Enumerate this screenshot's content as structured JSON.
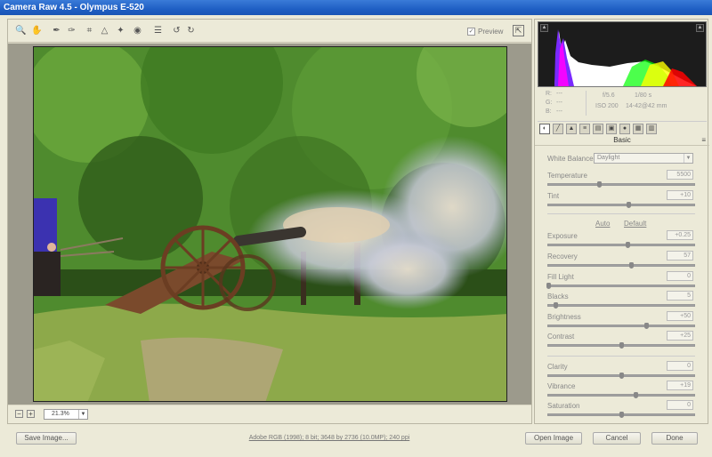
{
  "window": {
    "title": "Camera Raw 4.5  -  Olympus E-520"
  },
  "toolbar": {
    "tools": [
      "zoom-icon",
      "hand-icon",
      "white-balance-icon",
      "color-sampler-icon",
      "crop-icon",
      "straighten-icon",
      "retouch-icon",
      "red-eye-icon",
      "preferences-icon",
      "rotate-left-icon",
      "rotate-right-icon"
    ],
    "preview_label": "Preview",
    "preview_checked": true
  },
  "zoom": {
    "minus": "−",
    "plus": "+",
    "level": "21.3%"
  },
  "histogram": {
    "clip_shadow": "▲",
    "clip_highlight": "▲",
    "colors": [
      "#ffffff",
      "#7a29ff",
      "#ff00ff",
      "#ffff00",
      "#00ff00",
      "#ff0000"
    ]
  },
  "readout": {
    "r_label": "R:",
    "r_value": "---",
    "g_label": "G:",
    "g_value": "---",
    "b_label": "B:",
    "b_value": "---",
    "aperture": "f/5.6",
    "shutter": "1/80 s",
    "iso": "ISO 200",
    "lens": "14-42@42 mm"
  },
  "panel": {
    "section_title": "Basic",
    "white_balance": {
      "label": "White Balance:",
      "value": "Daylight"
    },
    "auto_label": "Auto",
    "default_label": "Default",
    "sliders": [
      {
        "label": "Temperature",
        "value": "5500",
        "position": 0.35
      },
      {
        "label": "Tint",
        "value": "+10",
        "position": 0.55
      },
      {
        "label": "Exposure",
        "value": "+0.25",
        "position": 0.54
      },
      {
        "label": "Recovery",
        "value": "57",
        "position": 0.57
      },
      {
        "label": "Fill Light",
        "value": "0",
        "position": 0.0
      },
      {
        "label": "Blacks",
        "value": "5",
        "position": 0.05
      },
      {
        "label": "Brightness",
        "value": "+50",
        "position": 0.67
      },
      {
        "label": "Contrast",
        "value": "+25",
        "position": 0.5
      },
      {
        "label": "Clarity",
        "value": "0",
        "position": 0.5
      },
      {
        "label": "Vibrance",
        "value": "+19",
        "position": 0.6
      },
      {
        "label": "Saturation",
        "value": "0",
        "position": 0.5
      }
    ]
  },
  "footer": {
    "save_label": "Save Image...",
    "workflow": "Adobe RGB (1998); 8 bit; 3648 by 2736 (10.0MP); 240 ppi",
    "open_label": "Open Image",
    "cancel_label": "Cancel",
    "done_label": "Done"
  }
}
